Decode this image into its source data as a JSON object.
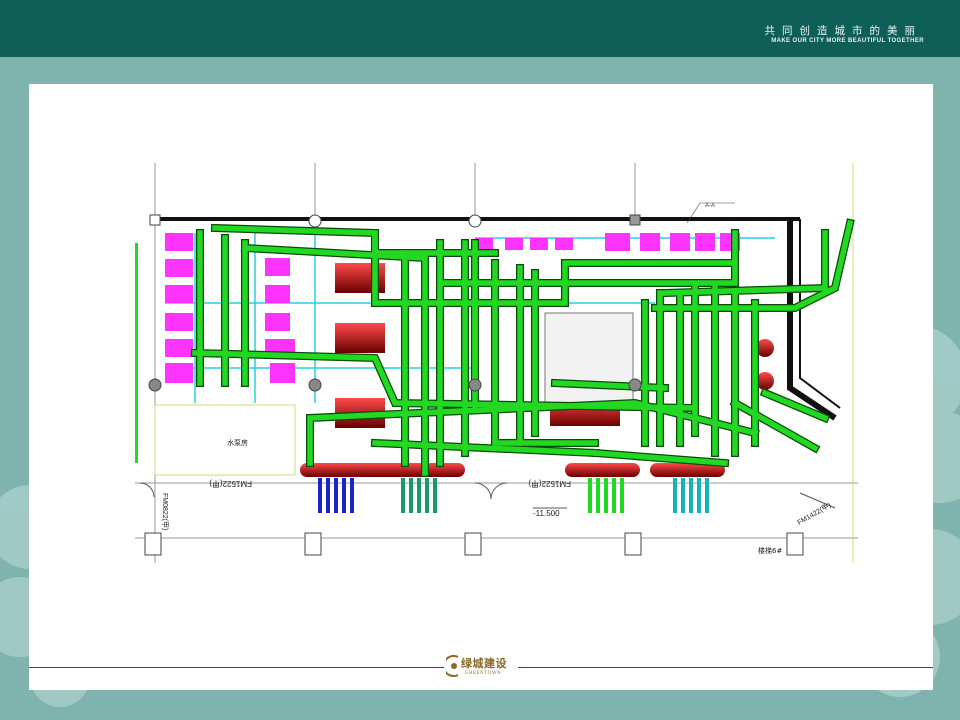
{
  "header": {
    "slogan_cn": "共同创造城市的美丽",
    "slogan_en": "MAKE OUR CITY MORE BEAUTIFUL TOGETHER"
  },
  "drawing": {
    "labels": {
      "pump_room": "水泵房",
      "door_left": "FM1522(甲)",
      "door_right": "FM1522(甲)",
      "door_side": "FM0822(甲)",
      "door_diag": "FM1422(甲)",
      "elevation": "-11.500",
      "stair": "楼梯6#",
      "tag": "A-A"
    },
    "colors": {
      "pipe_green": "#1fc11f",
      "pipe_outline": "#0a4a0a",
      "equipment_magenta": "#ff33ff",
      "tank_red": "#c81d1d",
      "pipe_blue": "#1c24c7",
      "pipe_cyan": "#15b5b5"
    }
  },
  "footer": {
    "logo_cn": "绿城建设",
    "logo_en": "GREENTOWN"
  }
}
